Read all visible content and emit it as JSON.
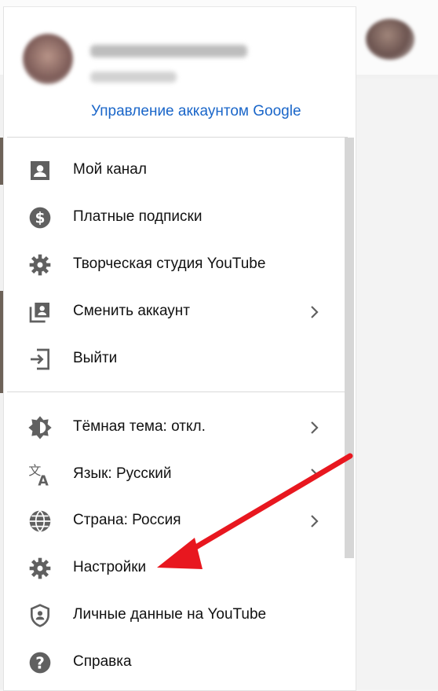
{
  "account": {
    "manage_label": "Управление аккаунтом Google"
  },
  "menu": {
    "group1": [
      {
        "label": "Мой канал",
        "icon": "account-box-icon",
        "chevron": false
      },
      {
        "label": "Платные подписки",
        "icon": "dollar-circle-icon",
        "chevron": false
      },
      {
        "label": "Творческая студия YouTube",
        "icon": "gear-icon",
        "chevron": false
      },
      {
        "label": "Сменить аккаунт",
        "icon": "switch-account-icon",
        "chevron": true
      },
      {
        "label": "Выйти",
        "icon": "sign-out-icon",
        "chevron": false
      }
    ],
    "group2": [
      {
        "label": "Тёмная тема: откл.",
        "icon": "brightness-icon",
        "chevron": true
      },
      {
        "label": "Язык: Русский",
        "icon": "translate-icon",
        "chevron": true
      },
      {
        "label": "Страна: Россия",
        "icon": "globe-icon",
        "chevron": true
      },
      {
        "label": "Настройки",
        "icon": "gear-icon",
        "chevron": false
      },
      {
        "label": "Личные данные на YouTube",
        "icon": "shield-person-icon",
        "chevron": false
      },
      {
        "label": "Справка",
        "icon": "help-icon",
        "chevron": false
      }
    ]
  },
  "colors": {
    "link": "#1a66c9",
    "icon": "#606060",
    "annotation_arrow": "#e8171f"
  }
}
